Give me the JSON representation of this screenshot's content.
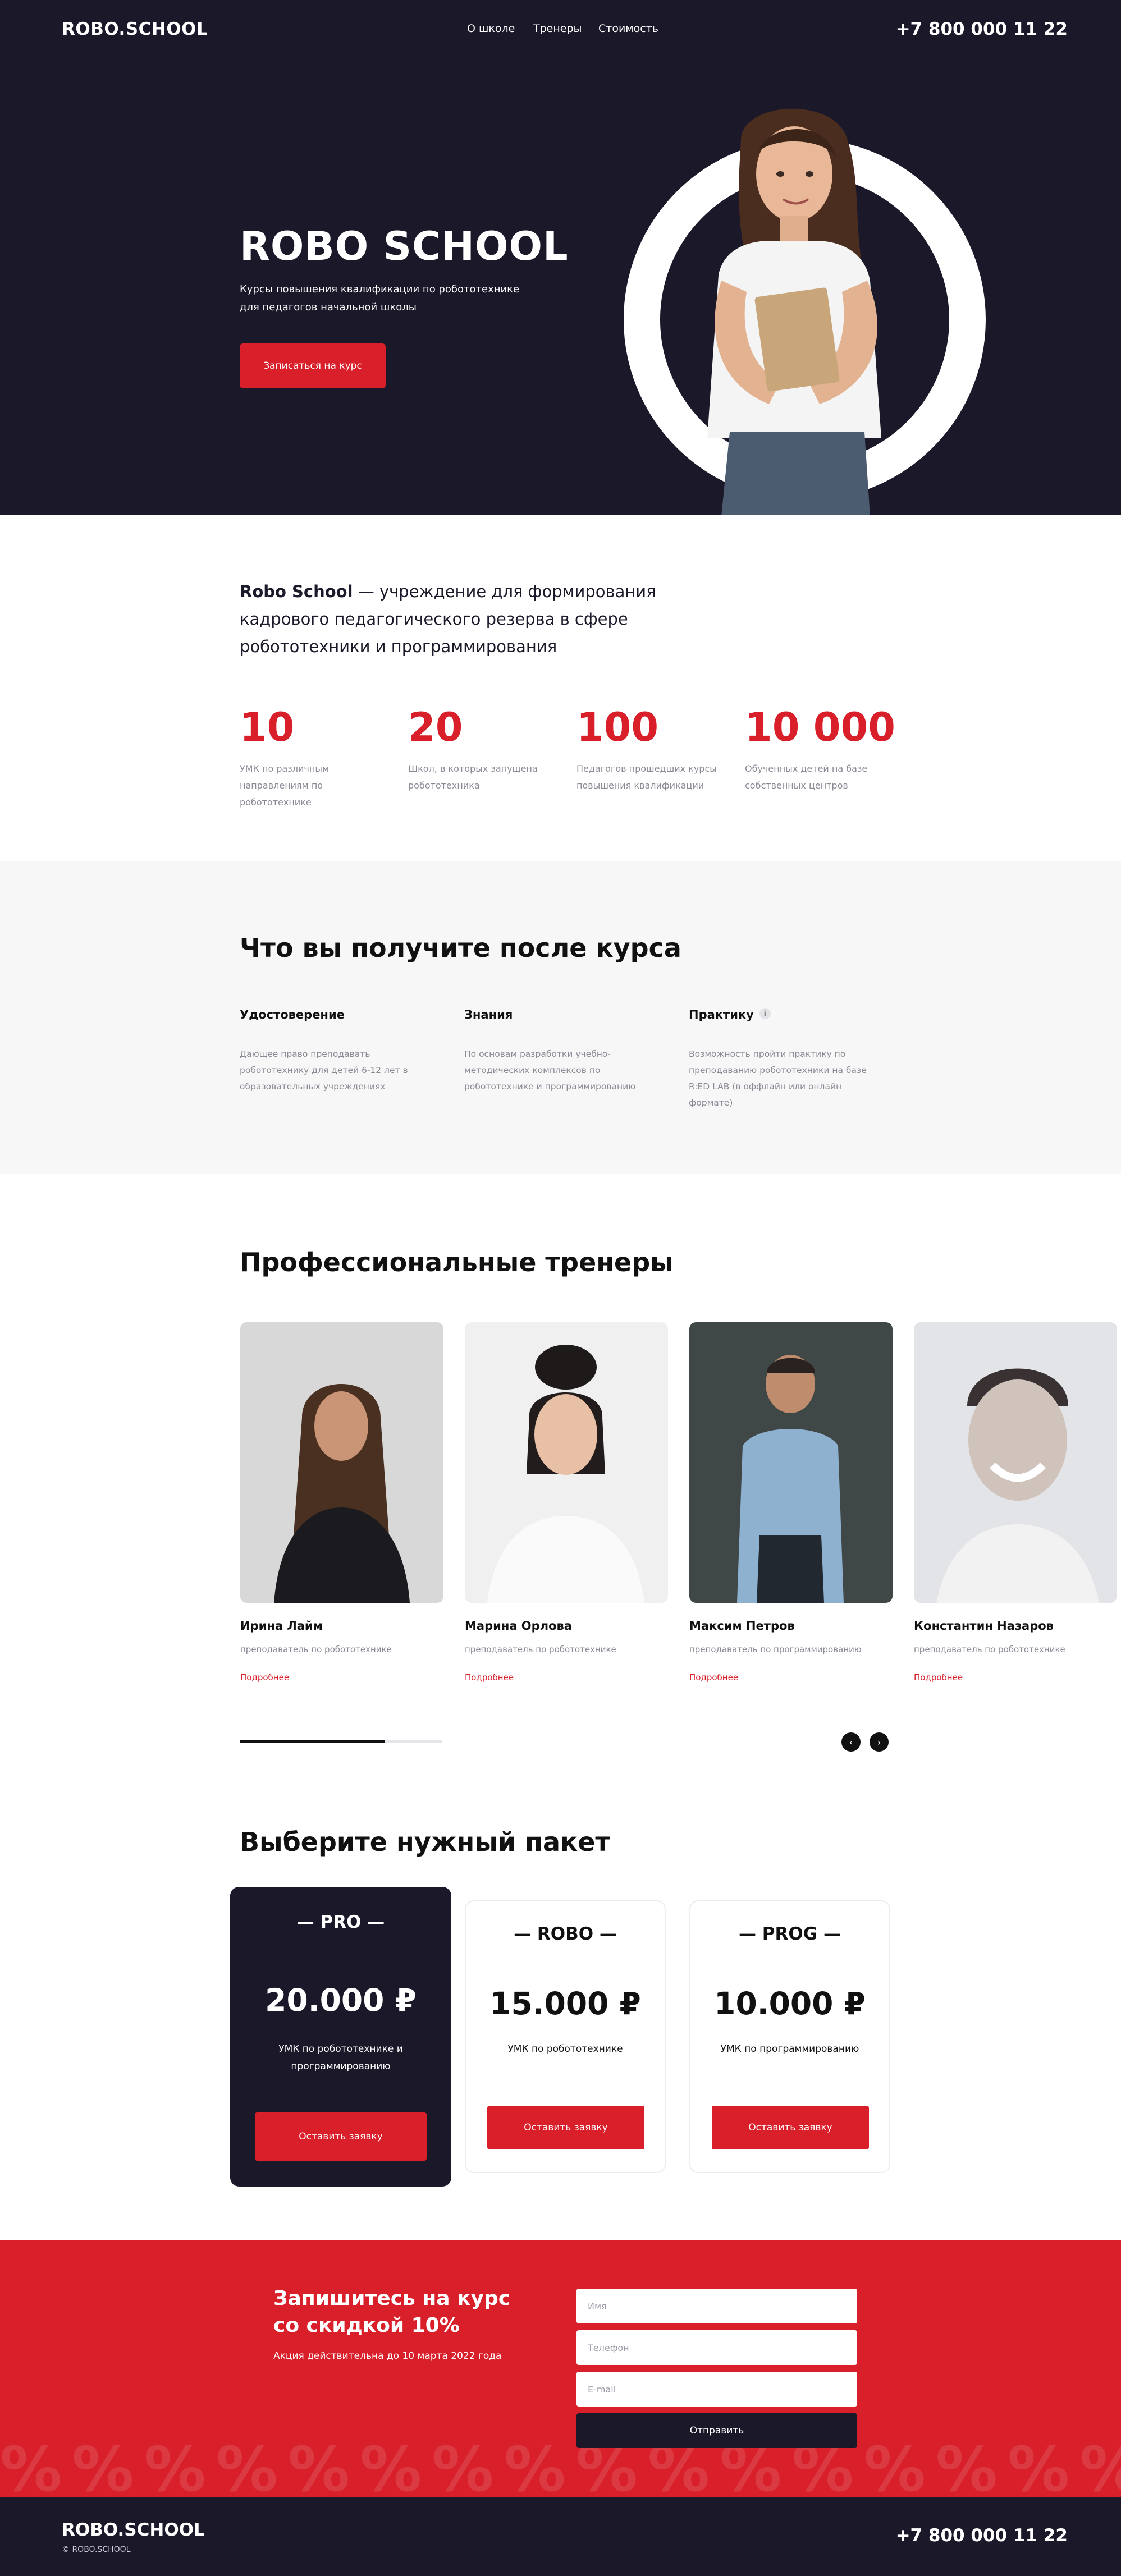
{
  "header": {
    "logo": "ROBO.SCHOOL",
    "nav": [
      "О школе",
      "Тренеры",
      "Стоимость"
    ],
    "phone": "+7 800 000 11 22"
  },
  "hero": {
    "title": "ROBO SCHOOL",
    "subtitle_line1": "Курсы повышения квалификации по робототехнике",
    "subtitle_line2": "для педагогов начальной школы",
    "cta": "Записаться на курс"
  },
  "about": {
    "brand": "Robo School",
    "text": " — учреждение для формирования кадрового педагогического резерва в сфере робототехники и программирования",
    "stats": [
      {
        "value": "10",
        "label": "УМК по различным направлениям по робототехнике"
      },
      {
        "value": "20",
        "label": "Школ, в которых запущена робототехника"
      },
      {
        "value": "100",
        "label": "Педагогов прошедших курсы повышения квалификации"
      },
      {
        "value": "10 000",
        "label": "Обученных детей на базе собственных центров"
      }
    ]
  },
  "benefits": {
    "title": "Что вы получите после курса",
    "items": [
      {
        "title": "Удостоверение",
        "desc": "Дающее право преподавать робототехнику для детей 6-12 лет в образовательных учреждениях"
      },
      {
        "title": "Знания",
        "desc": "По основам разработки учебно-методических комплексов по робототехнике и программированию"
      },
      {
        "title": "Практику",
        "desc": "Возможность пройти практику по преподаванию робототехники на базе R:ED LAB (в оффлайн или онлайн формате)"
      }
    ],
    "info_icon": "i"
  },
  "trainers": {
    "title": "Профессиональные тренеры",
    "more_label": "Подробнее",
    "items": [
      {
        "name": "Ирина Лайм",
        "role": "преподаватель по робототехнике"
      },
      {
        "name": "Марина Орлова",
        "role": "преподаватель по робототехнике"
      },
      {
        "name": "Максим Петров",
        "role": "преподаватель по программированию"
      },
      {
        "name": "Константин Назаров",
        "role": "преподаватель по робототехнике"
      }
    ],
    "slider_progress": 0.72,
    "prev_icon": "chevron-left-icon",
    "next_icon": "chevron-right-icon"
  },
  "pricing": {
    "title": "Выберите нужный пакет",
    "plans": [
      {
        "name": "— PRO —",
        "price": "20.000 ₽",
        "desc": "УМК по робототехнике и программированию",
        "button": "Оставить заявку",
        "highlight": true
      },
      {
        "name": "— ROBO —",
        "price": "15.000 ₽",
        "desc": "УМК по робототехнике",
        "button": "Оставить заявку",
        "highlight": false
      },
      {
        "name": "— PROG —",
        "price": "10.000 ₽",
        "desc": "УМК по программированию",
        "button": "Оставить заявку",
        "highlight": false
      }
    ]
  },
  "signup": {
    "title": "Запишитесь на курс со скидкой 10%",
    "note": "Акция действительна до 10 марта 2022 года",
    "name_placeholder": "Имя",
    "phone_placeholder": "Телефон",
    "email_placeholder": "E-mail",
    "submit": "Отправить",
    "pattern": "%%%%%%%%%%%%%%%%%%%%%%%%%%%%%%"
  },
  "footer": {
    "logo": "ROBO.SCHOOL",
    "copyright": "© ROBO.SCHOOL",
    "phone": "+7 800 000 11 22"
  },
  "colors": {
    "dark": "#1a1829",
    "accent": "#d81f2a",
    "light_bg": "#f7f7f7",
    "muted_text": "#8a8a95"
  }
}
